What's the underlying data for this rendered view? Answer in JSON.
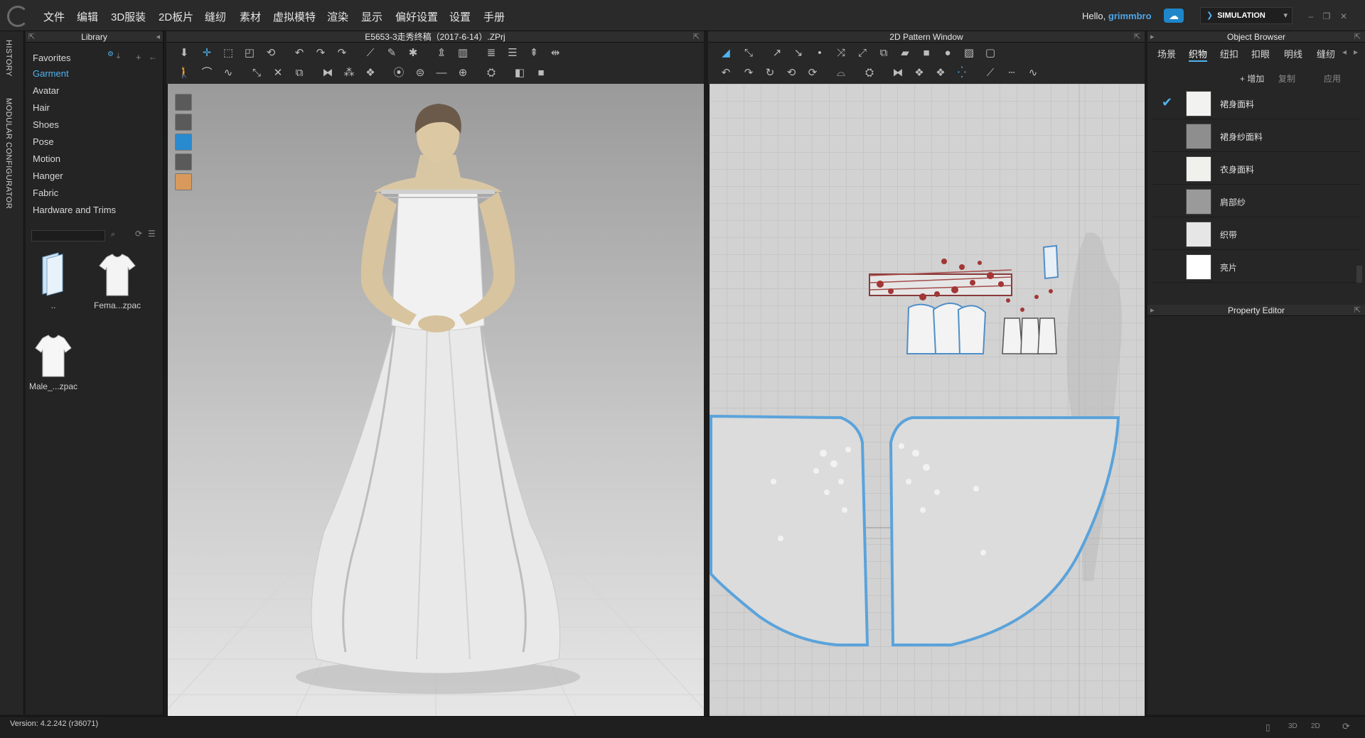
{
  "app": {
    "menu": [
      "文件",
      "编辑",
      "3D服装",
      "2D板片",
      "缝纫",
      "素材",
      "虚拟模特",
      "渲染",
      "显示",
      "偏好设置",
      "设置",
      "手册"
    ],
    "greeting": "Hello,",
    "username": "grimmbro",
    "simulation_label": "SIMULATION",
    "accent": "#4fb3ef"
  },
  "side_tabs": [
    "HISTORY",
    "MODULAR CONFIGURATOR"
  ],
  "library": {
    "title": "Library",
    "items": [
      "Favorites",
      "Garment",
      "Avatar",
      "Hair",
      "Shoes",
      "Pose",
      "Motion",
      "Hanger",
      "Fabric",
      "Hardware and Trims"
    ],
    "active_item": "Garment",
    "thumbnails": [
      {
        "label": "..",
        "icon": "folder-icon"
      },
      {
        "label": "Fema...zpac",
        "icon": "tshirt-icon"
      },
      {
        "label": "Male_...zpac",
        "icon": "tshirt-icon"
      }
    ]
  },
  "view3d": {
    "title": "E5653-3走秀终稿（2017-6-14）.ZPrj"
  },
  "view2d": {
    "title": "2D Pattern Window"
  },
  "object_browser": {
    "title": "Object Browser",
    "tabs": [
      "场景",
      "织物",
      "纽扣",
      "扣眼",
      "明线",
      "缝纫"
    ],
    "active_tab": "织物",
    "actions": [
      "+ 增加",
      "复制",
      "应用"
    ],
    "fabrics": [
      {
        "name": "裙身面料",
        "swatch": "#f2f2f0",
        "selected": true
      },
      {
        "name": "裙身纱面料",
        "swatch": "#8e8e8e",
        "selected": false
      },
      {
        "name": "衣身面料",
        "swatch": "#f0f0ec",
        "selected": false
      },
      {
        "name": "肩部纱",
        "swatch": "#9a9a9a",
        "selected": false
      },
      {
        "name": "织带",
        "swatch": "#e6e6e6",
        "selected": false
      },
      {
        "name": "亮片",
        "swatch": "#ffffff",
        "selected": false
      }
    ]
  },
  "property_editor": {
    "title": "Property Editor"
  },
  "status": {
    "version": "Version: 4.2.242 (r36071)"
  }
}
